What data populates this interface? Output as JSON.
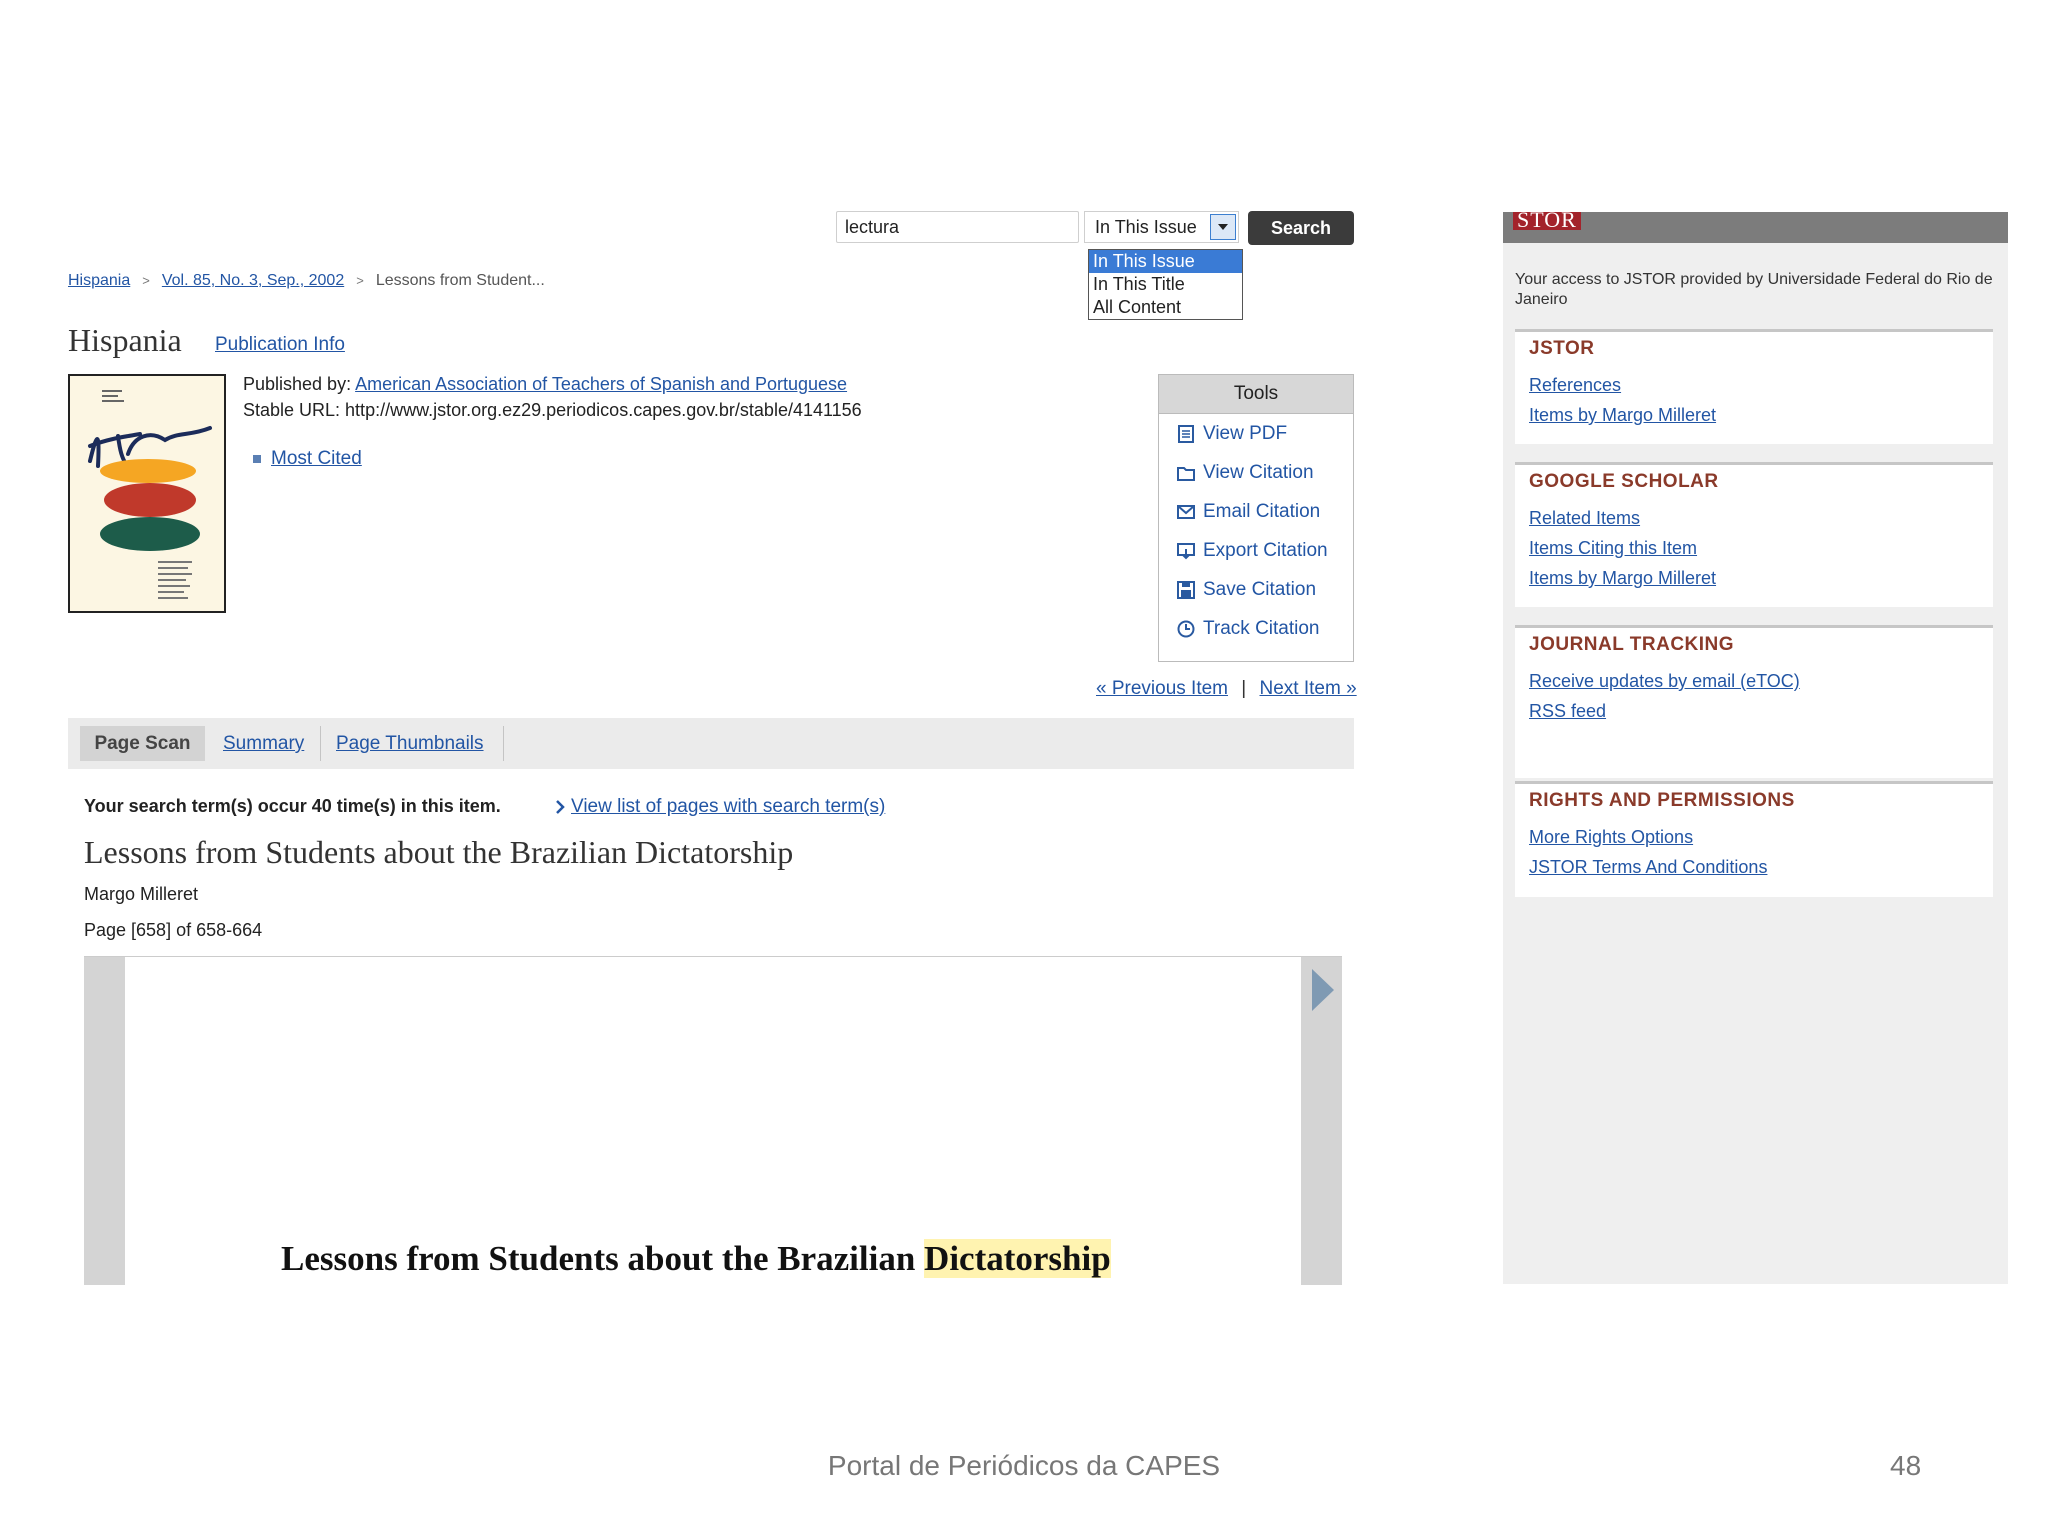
{
  "search": {
    "value": "lectura",
    "scope_selected": "In This Issue",
    "scope_options": [
      "In This Issue",
      "In This Title",
      "All Content"
    ],
    "button_label": "Search"
  },
  "breadcrumb": [
    "Hispania",
    "Vol. 85, No. 3, Sep., 2002",
    "Lessons from Student..."
  ],
  "journal": {
    "title": "Hispania",
    "pub_info_link": "Publication Info",
    "published_by_label": "Published by:",
    "publisher": "American Association of Teachers of Spanish and Portuguese",
    "stable_url": "Stable URL: http://www.jstor.org.ez29.periodicos.capes.gov.br/stable/4141156",
    "most_cited": "Most Cited"
  },
  "tools": {
    "header": "Tools",
    "items": [
      "View PDF",
      "View Citation",
      "Email Citation",
      "Export Citation",
      "Save Citation",
      "Track Citation"
    ]
  },
  "item_nav": {
    "previous": "«  Previous Item",
    "separator": "|",
    "next": "Next Item  »"
  },
  "tabs": [
    "Page Scan",
    "Summary",
    "Page Thumbnails"
  ],
  "article": {
    "search_occurrences": "Your search term(s) occur 40 time(s) in this item.",
    "view_pages_link": "View list of pages with search term(s)",
    "title": "Lessons from Students about the Brazilian Dictatorship",
    "author": "Margo Milleret",
    "page": "Page [658] of 658-664",
    "scan_title_prefix": "Lessons from Students about the Brazilian ",
    "scan_title_highlight": "Dictatorship"
  },
  "sidebar": {
    "logo": "STOR",
    "access_text": "Your access to JSTOR provided by Universidade Federal do Rio de Janeiro",
    "panels": [
      {
        "heading": "JSTOR",
        "links": [
          "References",
          "Items by Margo Milleret"
        ]
      },
      {
        "heading": "GOOGLE SCHOLAR",
        "links": [
          "Related Items",
          "Items Citing this Item",
          "Items by Margo Milleret"
        ]
      },
      {
        "heading": "JOURNAL TRACKING",
        "links": [
          "Receive updates by email (eTOC)",
          "RSS feed"
        ]
      },
      {
        "heading": "RIGHTS AND PERMISSIONS",
        "links": [
          "More Rights Options",
          "JSTOR Terms And Conditions"
        ]
      }
    ]
  },
  "footer": {
    "text": "Portal de Periódicos da CAPES",
    "page_number": "48"
  },
  "colors": {
    "link": "#2255a4",
    "jstor_red": "#a3232b",
    "highlight": "#fff3b0",
    "heading_brown": "#8a3a2a"
  }
}
